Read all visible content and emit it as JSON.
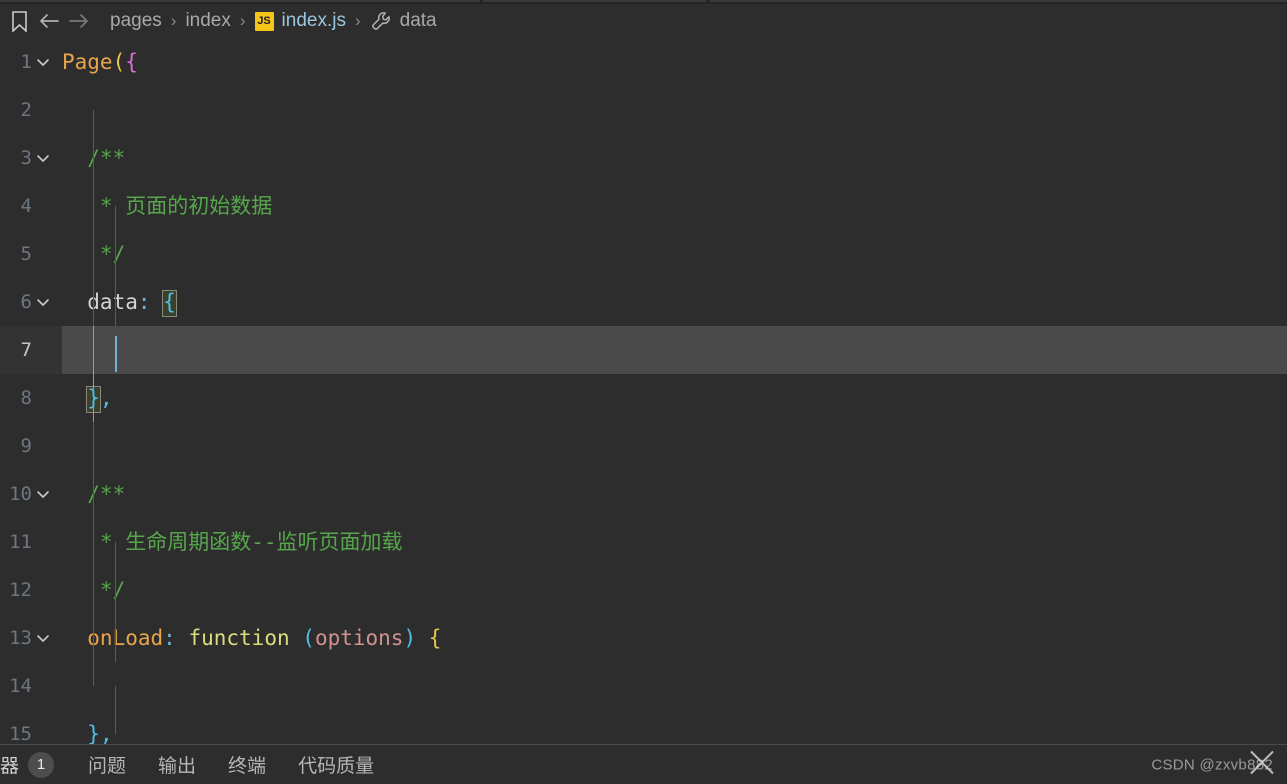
{
  "window": {
    "theme": "dark",
    "colors": {
      "editor_background": "#2d2d2d",
      "active_line": "#4a4a4a",
      "comment": "#56a64b",
      "function_keyword": "#dcdc7d",
      "property": "#e8a44c",
      "parameter": "#d0928f",
      "bracket_level_1": "#e8c84c",
      "bracket_level_2": "#da70d6",
      "bracket_level_3": "#4fc1e9",
      "js_badge": "#f5c518",
      "caret": "#6fb3d2"
    }
  },
  "breadcrumb": {
    "bookmark_icon": "bookmark-icon",
    "back_icon": "arrow-left-icon",
    "forward_icon": "arrow-right-icon",
    "items": [
      {
        "label": "pages",
        "icon": null,
        "kind": "folder"
      },
      {
        "label": "index",
        "icon": null,
        "kind": "folder"
      },
      {
        "label": "index.js",
        "icon": "js-badge",
        "kind": "file"
      },
      {
        "label": "data",
        "icon": "wrench-icon",
        "kind": "symbol"
      }
    ],
    "separator": "›",
    "js_badge_text": "JS"
  },
  "editor": {
    "language": "javascript",
    "file": "index.js",
    "active_line_number": 7,
    "cursor": {
      "line": 7,
      "column": 3
    },
    "lines": [
      {
        "number": "1",
        "folded": false,
        "has_fold_chevron": true,
        "tokens": [
          {
            "text": "Page",
            "type": "function"
          },
          {
            "text": "(",
            "type": "bracket1"
          },
          {
            "text": "{",
            "type": "bracket2"
          }
        ]
      },
      {
        "number": "2",
        "has_fold_chevron": false,
        "tokens": []
      },
      {
        "number": "3",
        "has_fold_chevron": true,
        "tokens": [
          {
            "text": "  /**",
            "type": "comment"
          }
        ]
      },
      {
        "number": "4",
        "has_fold_chevron": false,
        "tokens": [
          {
            "text": "   * 页面的初始数据",
            "type": "comment"
          }
        ]
      },
      {
        "number": "5",
        "has_fold_chevron": false,
        "tokens": [
          {
            "text": "   */",
            "type": "comment"
          }
        ]
      },
      {
        "number": "6",
        "has_fold_chevron": true,
        "tokens": [
          {
            "text": "  data",
            "type": "plain"
          },
          {
            "text": ":",
            "type": "colon"
          },
          {
            "text": " ",
            "type": "plain"
          },
          {
            "text": "{",
            "type": "bracket3",
            "bracket_match": true
          }
        ]
      },
      {
        "number": "7",
        "has_fold_chevron": false,
        "active": true,
        "tokens": []
      },
      {
        "number": "8",
        "has_fold_chevron": false,
        "tokens": [
          {
            "text": "  ",
            "type": "plain"
          },
          {
            "text": "}",
            "type": "bracket3",
            "bracket_match": true
          },
          {
            "text": ",",
            "type": "bracket3"
          }
        ]
      },
      {
        "number": "9",
        "has_fold_chevron": false,
        "tokens": []
      },
      {
        "number": "10",
        "has_fold_chevron": true,
        "tokens": [
          {
            "text": "  /**",
            "type": "comment"
          }
        ]
      },
      {
        "number": "11",
        "has_fold_chevron": false,
        "tokens": [
          {
            "text": "   * 生命周期函数--监听页面加载",
            "type": "comment"
          }
        ]
      },
      {
        "number": "12",
        "has_fold_chevron": false,
        "tokens": [
          {
            "text": "   */",
            "type": "comment"
          }
        ]
      },
      {
        "number": "13",
        "has_fold_chevron": true,
        "tokens": [
          {
            "text": "  onLoad",
            "type": "property"
          },
          {
            "text": ":",
            "type": "colon"
          },
          {
            "text": " ",
            "type": "plain"
          },
          {
            "text": "function",
            "type": "keyword"
          },
          {
            "text": " ",
            "type": "plain"
          },
          {
            "text": "(",
            "type": "bracket3"
          },
          {
            "text": "options",
            "type": "parameter"
          },
          {
            "text": ")",
            "type": "bracket3"
          },
          {
            "text": " ",
            "type": "plain"
          },
          {
            "text": "{",
            "type": "bracket1"
          }
        ]
      },
      {
        "number": "14",
        "has_fold_chevron": false,
        "tokens": []
      },
      {
        "number": "15",
        "has_fold_chevron": false,
        "tokens": [
          {
            "text": "  ",
            "type": "plain"
          },
          {
            "text": "}",
            "type": "bracket3"
          },
          {
            "text": ",",
            "type": "bracket3"
          }
        ]
      }
    ]
  },
  "panel": {
    "truncated_tab": "器",
    "badge_count": "1",
    "tabs": [
      {
        "label": "问题"
      },
      {
        "label": "输出"
      },
      {
        "label": "终端"
      },
      {
        "label": "代码质量"
      }
    ]
  },
  "watermark": {
    "text": "CSDN @zxvb882"
  }
}
